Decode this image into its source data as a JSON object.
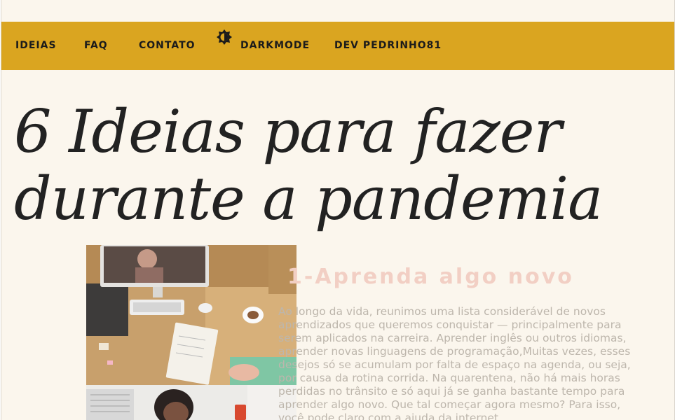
{
  "nav": {
    "items": [
      "IDEIAS",
      "FAQ",
      "CONTATO"
    ],
    "darkmode_label": "DARKMODE",
    "dev_label": "DEV  PEDRINHO81",
    "darkmode_icon": "brightness-contrast-icon",
    "background": "#daa520"
  },
  "hero": {
    "title": "6 Ideias para fazer durante a pandemia"
  },
  "section1": {
    "title": "1-Aprenda algo novo",
    "body": "Ao longo da vida, reunimos uma lista considerável de novos aprendizados que queremos conquistar — principalmente para serem aplicados na carreira. Aprender inglês ou outros idiomas, aprender novas linguagens de programação,Muitas vezes, esses desejos só se acumulam por falta de espaço na agenda, ou seja, por causa da rotina corrida. Na quarentena, não há mais horas perdidas no trânsito e só aqui já se ganha bastante tempo para aprender algo novo. Que tal começar agora mesmo? Para isso, você pode claro com a ajuda da internet."
  },
  "images": {
    "first": "person-video-call-at-desk-photo",
    "second": "person-with-phone-photo"
  }
}
